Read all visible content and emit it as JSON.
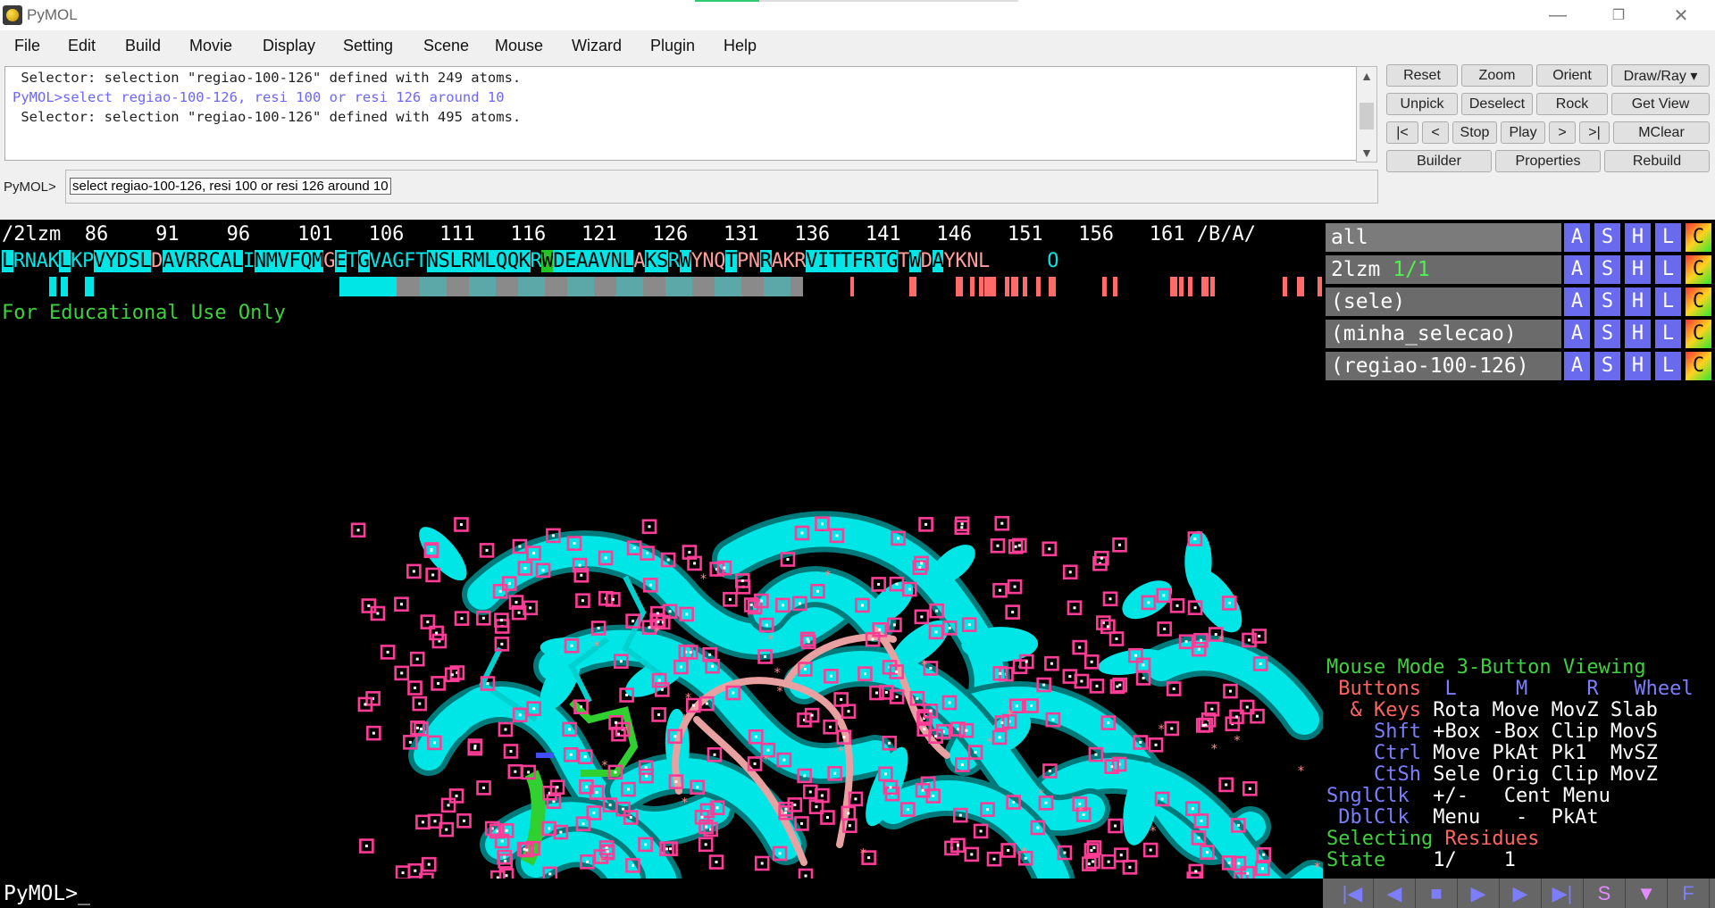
{
  "window": {
    "title": "PyMOL",
    "controls": {
      "minimize": "—",
      "restore": "❐",
      "close": "✕"
    }
  },
  "menu": [
    "File",
    "Edit",
    "Build",
    "Movie",
    "Display",
    "Setting",
    "Scene",
    "Mouse",
    "Wizard",
    "Plugin",
    "Help"
  ],
  "console": {
    "lines": [
      " Selector: selection \"regiao-100-126\" defined with 249 atoms.",
      "PyMOL>select regiao-100-126, resi 100 or resi 126 around 10",
      " Selector: selection \"regiao-100-126\" defined with 495 atoms."
    ],
    "scroll_up": "▲",
    "scroll_down": "▼"
  },
  "command": {
    "label": "PyMOL>",
    "value": "select regiao-100-126, resi 100 or resi 126 around 10"
  },
  "buttons": {
    "row1": [
      "Reset",
      "Zoom",
      "Orient",
      "Draw/Ray ▾"
    ],
    "row2": [
      "Unpick",
      "Deselect",
      "Rock",
      "Get View"
    ],
    "row3": [
      "|<",
      "<",
      "Stop",
      "Play",
      ">",
      ">|",
      "MClear"
    ],
    "row4": [
      "Builder",
      "Properties",
      "Rebuild"
    ]
  },
  "sequence": {
    "numbers": "/2lzm  86    91    96    101   106   111   116   121   126   131   136   141   146   151   156   161 /B/A/",
    "residues": "LRNAKLKPVYDSLDAVRRCALINMVFQMGETGVAGFTNSLRMLQQKRWDEAAVNLAKSRWYNQTPNRAKRVITTFRTGTWDAYKNL     O"
  },
  "watermark": "For Educational Use Only",
  "objects": [
    {
      "name": "all",
      "sub": ""
    },
    {
      "name": "2lzm",
      "sub": "1/1"
    },
    {
      "name": "(sele)",
      "sub": ""
    },
    {
      "name": "(minha_selecao)",
      "sub": ""
    },
    {
      "name": "(regiao-100-126)",
      "sub": ""
    }
  ],
  "object_actions": [
    "A",
    "S",
    "H",
    "L",
    "C"
  ],
  "mouse_mode": {
    "title_a": "Mouse Mode ",
    "title_b": "3-Button Viewing",
    "header": [
      " Buttons ",
      " L    ",
      " M    ",
      " R  ",
      " Wheel"
    ],
    "rows": [
      [
        "  & Keys",
        " Rota",
        " Move",
        " MovZ",
        " Slab"
      ],
      [
        "    Shft",
        " +Box",
        " -Box",
        " Clip",
        " MovS"
      ],
      [
        "    Ctrl",
        " Move",
        " PkAt",
        " Pk1 ",
        " MvSZ"
      ],
      [
        "    CtSh",
        " Sele",
        " Orig",
        " Clip",
        " MovZ"
      ],
      [
        "SnglClk ",
        " +/- ",
        "  Cent",
        " Menu",
        ""
      ],
      [
        " DblClk ",
        " Menu",
        "   - ",
        " PkAt",
        ""
      ]
    ],
    "selecting_a": "Selecting ",
    "selecting_b": "Residues",
    "state_label": "State",
    "state_value": "    1/    1"
  },
  "bottom_prompt": "PyMOL>_",
  "movie_controls": [
    "|◀",
    "◀",
    "■",
    "▶",
    "▶",
    "▶|",
    "S",
    "▼",
    "F"
  ],
  "colors": {
    "cyan": "#00e5e5",
    "pink_marker": "#ff3c96",
    "green_text": "#3fd13f",
    "button_blue": "#6a6aee"
  }
}
